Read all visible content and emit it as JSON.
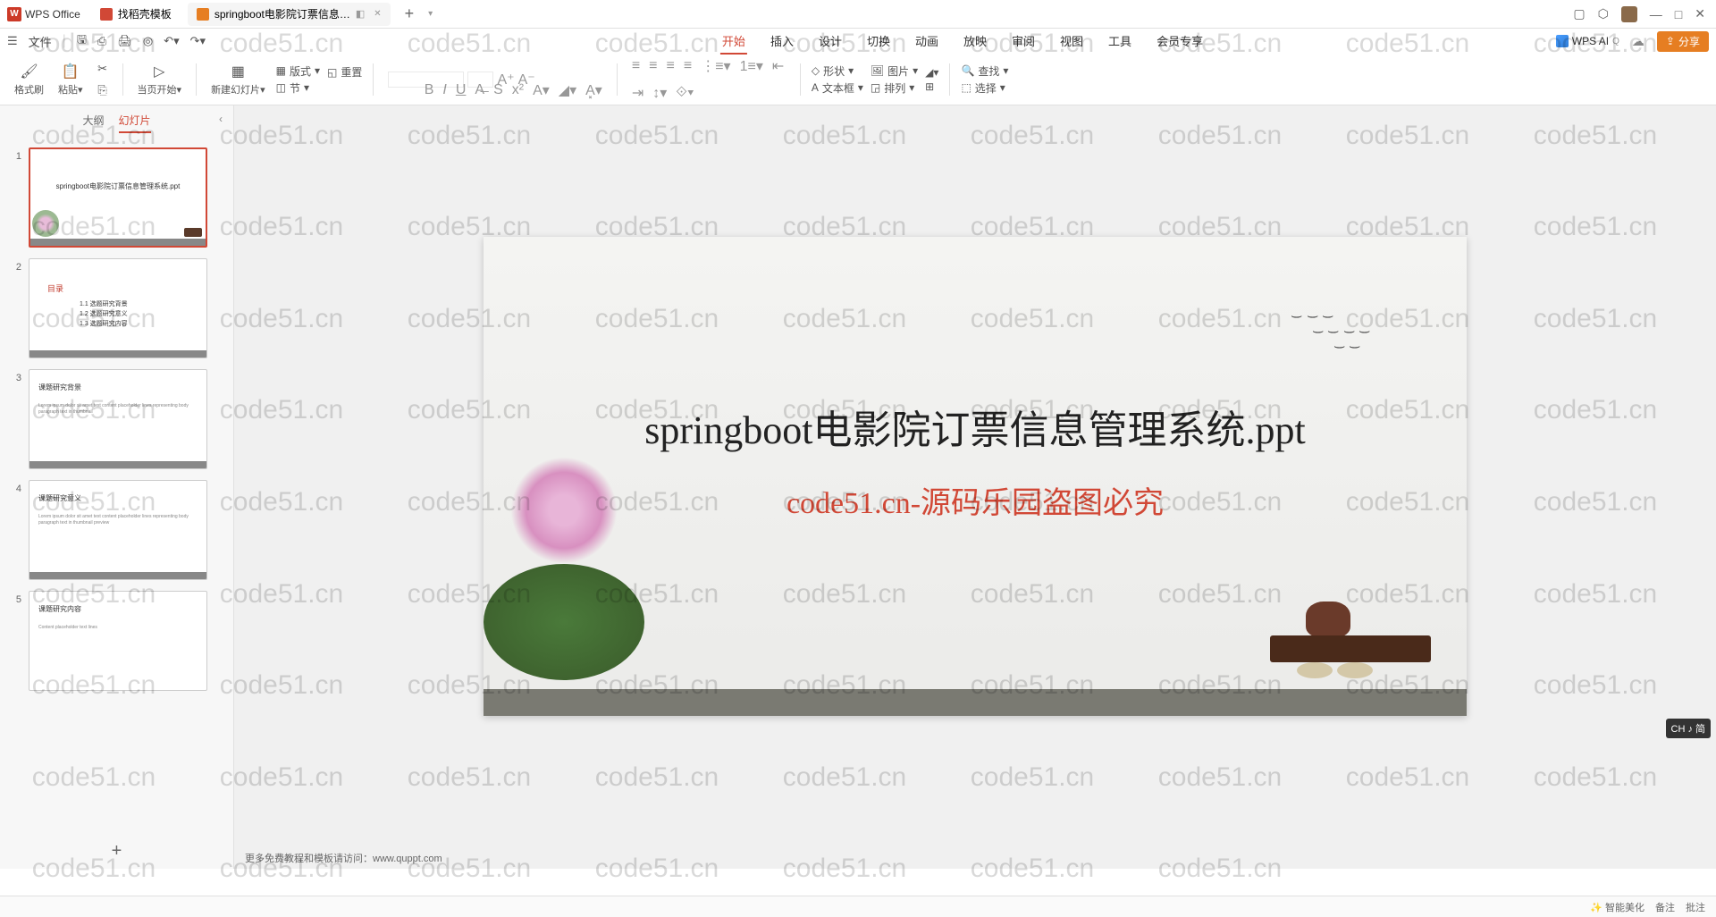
{
  "app_name": "WPS Office",
  "tabs": [
    {
      "label": "找稻壳模板",
      "icon": "red"
    },
    {
      "label": "springboot电影院订票信息…",
      "icon": "orange",
      "active": true
    }
  ],
  "window_controls": {
    "minimize": "—",
    "maximize": "□",
    "close": "✕"
  },
  "quick_access": {
    "file": "文件"
  },
  "menu": {
    "items": [
      "开始",
      "插入",
      "设计",
      "切换",
      "动画",
      "放映",
      "审阅",
      "视图",
      "工具",
      "会员专享"
    ],
    "active": "开始",
    "wps_ai": "WPS AI",
    "share": "分享"
  },
  "ribbon": {
    "format_painter": "格式刷",
    "paste": "粘贴",
    "from_current": "当页开始",
    "new_slide": "新建幻灯片",
    "layout": "版式",
    "section": "节",
    "reset": "重置",
    "shape": "形状",
    "picture": "图片",
    "textbox": "文本框",
    "arrange": "排列",
    "find": "查找",
    "select": "选择"
  },
  "side_panel": {
    "outline": "大纲",
    "slides": "幻灯片",
    "active": "幻灯片"
  },
  "thumbs": [
    {
      "num": 1,
      "title": "springboot电影院订票信息管理系统.ppt",
      "selected": true,
      "type": "title"
    },
    {
      "num": 2,
      "title": "目录",
      "type": "toc",
      "items": [
        "1.1 选题研究背景",
        "1.2 选题研究意义",
        "1.3 选题研究内容"
      ]
    },
    {
      "num": 3,
      "title": "课题研究背景",
      "type": "content"
    },
    {
      "num": 4,
      "title": "课题研究意义",
      "type": "content"
    },
    {
      "num": 5,
      "title": "课题研究内容",
      "type": "content"
    }
  ],
  "slide": {
    "title": "springboot电影院订票信息管理系统.ppt",
    "watermark": "code51.cn-源码乐园盗图必究"
  },
  "canvas_footer": "更多免费教程和模板请访问：www.quppt.com",
  "ime": "CH ♪ 简",
  "watermark_text": "code51.cn",
  "statusbar": {
    "beautify": "智能美化",
    "notes": "备注",
    "comments": "批注"
  }
}
